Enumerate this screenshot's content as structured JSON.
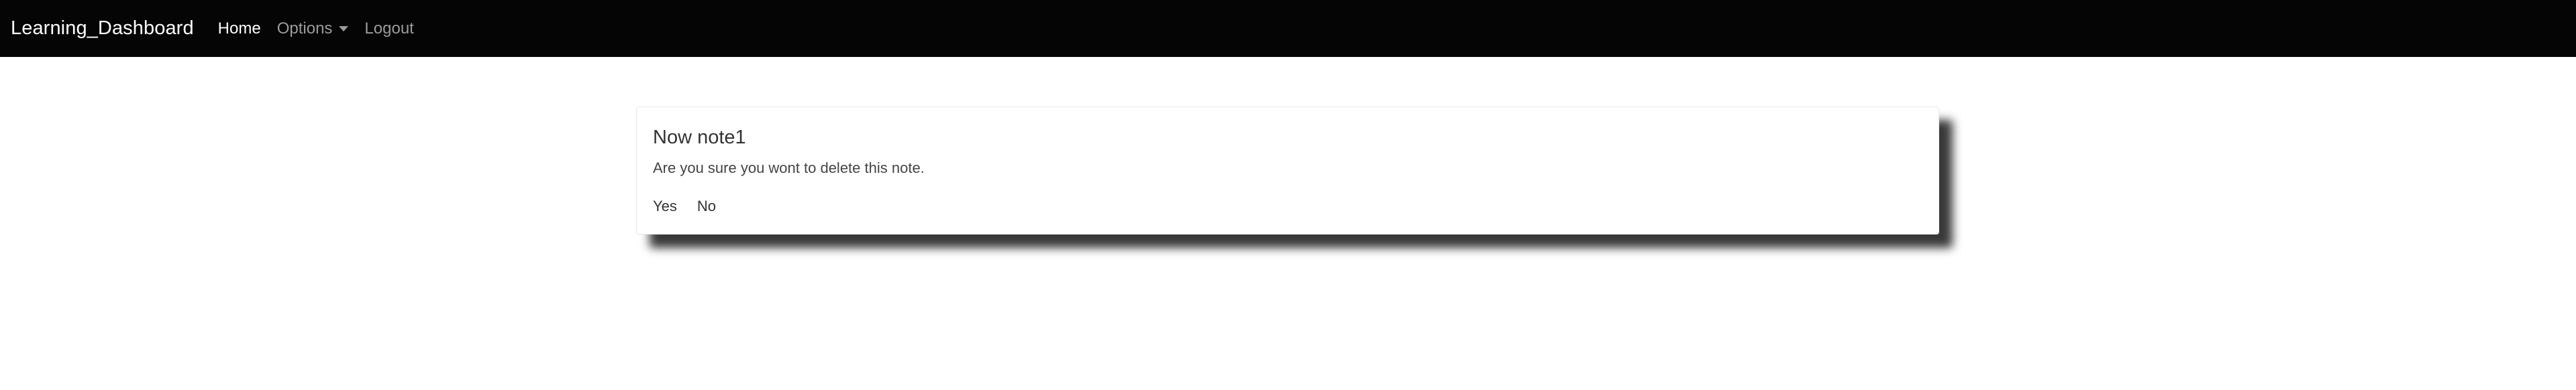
{
  "navbar": {
    "brand": "Learning_Dashboard",
    "home": "Home",
    "options": "Options",
    "logout": "Logout"
  },
  "dialog": {
    "title": "Now note1",
    "message": "Are you sure you wont to delete this note.",
    "yes": "Yes",
    "no": "No"
  },
  "colors": {
    "navbar_background": "#050505",
    "active_nav_text": "#ffffff",
    "inactive_nav_text": "#9b9b9b"
  },
  "icons": {
    "options_dropdown": "chevron-down-icon"
  }
}
